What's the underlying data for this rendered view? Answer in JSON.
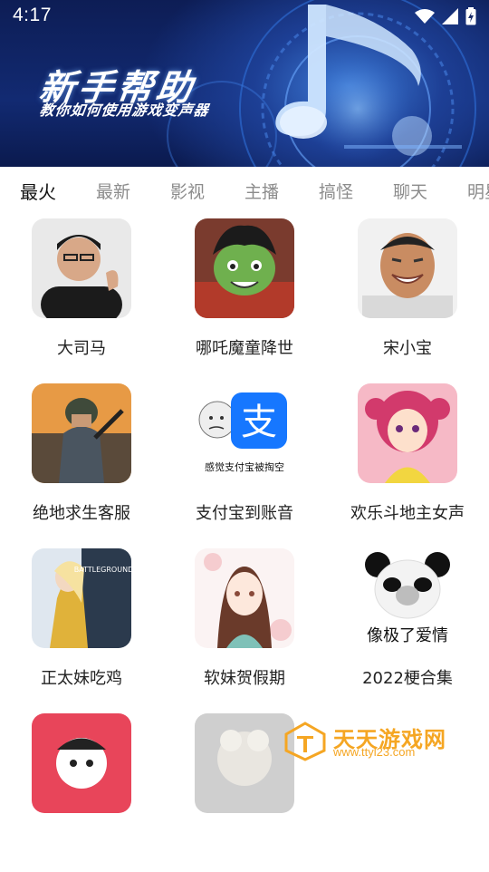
{
  "status": {
    "time": "4:17"
  },
  "banner": {
    "title": "新手帮助",
    "subtitle": "教你如何使用游戏变声器"
  },
  "tabs": [
    "最火",
    "最新",
    "影视",
    "主播",
    "搞怪",
    "聊天",
    "明星"
  ],
  "items": [
    {
      "label": "大司马"
    },
    {
      "label": "哪吒魔童降世"
    },
    {
      "label": "宋小宝"
    },
    {
      "label": "绝地求生客服"
    },
    {
      "label": "支付宝到账音",
      "thumb_text": "感觉支付宝被掏空",
      "thumb_icon": "支"
    },
    {
      "label": "欢乐斗地主女声"
    },
    {
      "label": "正太妹吃鸡",
      "thumb_text": "BATTLEGROUNDS"
    },
    {
      "label": "软妹贺假期"
    },
    {
      "label": "2022梗合集",
      "thumb_text": "像极了爱情"
    },
    {
      "label": ""
    },
    {
      "label": ""
    }
  ],
  "watermark": {
    "name": "天天游戏网",
    "url": "www.ttyl23.com"
  },
  "colors": {
    "accent": "#f5a623",
    "banner_dark": "#0d1d55",
    "tab_active": "#111111",
    "tab_inactive": "#8c8c8c"
  }
}
